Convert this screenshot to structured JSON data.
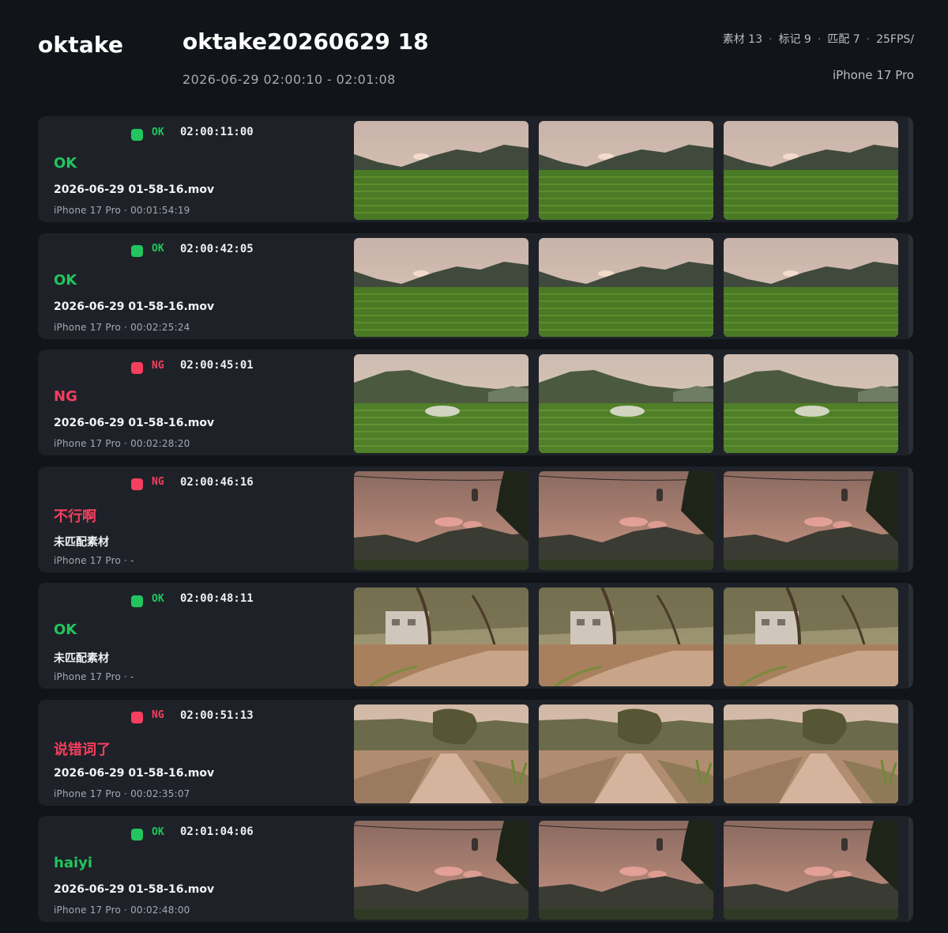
{
  "header": {
    "brand": "oktake",
    "title": "oktake20260629 18",
    "time_range": "2026-06-29 02:00:10 - 02:01:08",
    "stats": [
      "素材 13",
      "标记 9",
      "匹配 7",
      "25FPS/"
    ],
    "device": "iPhone 17 Pro"
  },
  "scene_palettes": {
    "field": {
      "sky_top": "#c8b3aa",
      "sky_bottom": "#e0c6b6",
      "mountain": "#3f4a3c",
      "ground": "#4a7a25",
      "accent": "#6f9e35"
    },
    "field_hill": {
      "sky_top": "#cdbcb1",
      "sky_bottom": "#e1cbbb",
      "mountain": "#4b5a3f",
      "ground": "#4f7f28",
      "accent": "#7aa43d"
    },
    "dusk": {
      "sky_top": "#8a6a60",
      "sky_bottom": "#c89482",
      "mountain": "#3a3b33",
      "ground": "#2f3a24",
      "accent": "#e8a39a"
    },
    "village": {
      "sky_top": "#8f8a67",
      "sky_bottom": "#a79d78",
      "mountain": "#5d5a3d",
      "ground": "#a8805e",
      "accent": "#c8a488"
    },
    "road": {
      "sky_top": "#d2b8a6",
      "sky_bottom": "#e0c5b2",
      "mountain": "#6b6a4a",
      "ground": "#b08d70",
      "accent": "#d4b49c"
    }
  },
  "rows": [
    {
      "status": "OK",
      "status_class": "ok",
      "timecode": "02:00:11:00",
      "note": "OK",
      "file": "2026-06-29 01-58-16.mov",
      "sub": "iPhone 17 Pro · 00:01:54:19",
      "scene": "field"
    },
    {
      "status": "OK",
      "status_class": "ok",
      "timecode": "02:00:42:05",
      "note": "OK",
      "file": "2026-06-29 01-58-16.mov",
      "sub": "iPhone 17 Pro · 00:02:25:24",
      "scene": "field"
    },
    {
      "status": "NG",
      "status_class": "ng",
      "timecode": "02:00:45:01",
      "note": "NG",
      "file": "2026-06-29 01-58-16.mov",
      "sub": "iPhone 17 Pro · 00:02:28:20",
      "scene": "field_hill"
    },
    {
      "status": "NG",
      "status_class": "ng",
      "timecode": "02:00:46:16",
      "note": "不行啊",
      "file": "未匹配素材",
      "sub": "iPhone 17 Pro · -",
      "scene": "dusk"
    },
    {
      "status": "OK",
      "status_class": "ok",
      "timecode": "02:00:48:11",
      "note": "OK",
      "file": "未匹配素材",
      "sub": "iPhone 17 Pro · -",
      "scene": "village"
    },
    {
      "status": "NG",
      "status_class": "ng",
      "timecode": "02:00:51:13",
      "note": "说错词了",
      "file": "2026-06-29 01-58-16.mov",
      "sub": "iPhone 17 Pro · 00:02:35:07",
      "scene": "road"
    },
    {
      "status": "OK",
      "status_class": "ok",
      "timecode": "02:01:04:06",
      "note": "haiyi",
      "file": "2026-06-29 01-58-16.mov",
      "sub": "iPhone 17 Pro · 00:02:48:00",
      "scene": "dusk"
    }
  ]
}
